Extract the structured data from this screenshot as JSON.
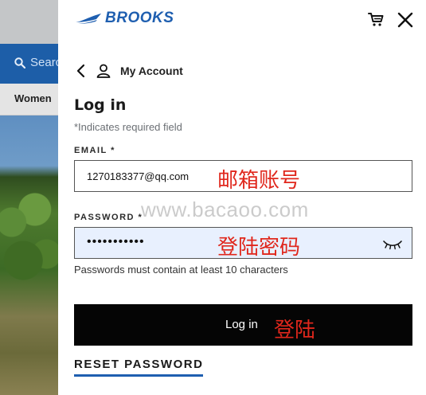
{
  "background": {
    "search_placeholder": "Searc",
    "nav_item": "Women"
  },
  "header": {
    "brand": "BROOKS",
    "icons": [
      "cart-icon",
      "close-icon"
    ]
  },
  "account": {
    "label": "My Account"
  },
  "form": {
    "title": "Log in",
    "required_note": "*Indicates required field",
    "email_label": "EMAIL *",
    "email_value": "1270183377@qq.com",
    "email_overlay": "邮箱账号",
    "password_label": "PASSWORD *",
    "password_value": "•••••••••••",
    "password_overlay": "登陆密码",
    "password_hint": "Passwords must contain at least 10 characters",
    "login_button": "Log in",
    "login_overlay": "登陆",
    "reset_link": "RESET PASSWORD"
  },
  "watermark": "www.bacaoo.com",
  "colors": {
    "brand_blue": "#1f5fb0",
    "button_black": "#050505",
    "overlay_red": "#e0271c",
    "autofill_blue": "#e8f0fe"
  }
}
